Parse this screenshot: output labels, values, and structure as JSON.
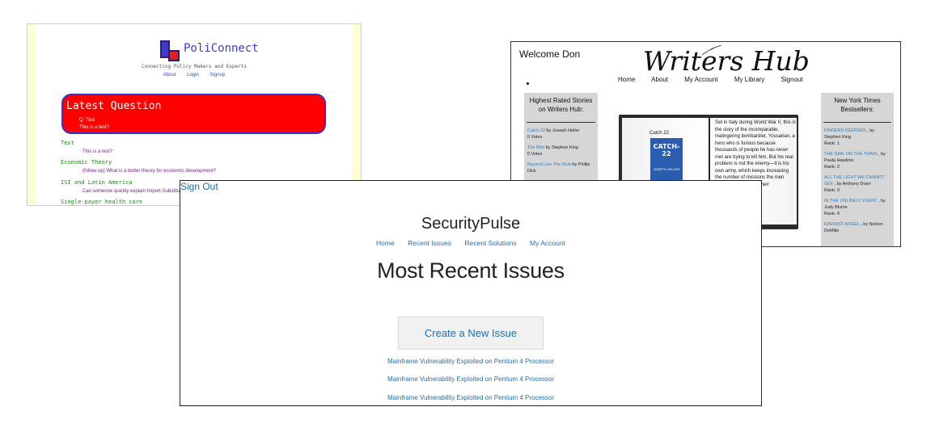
{
  "poliConnect": {
    "brand": "PoliConnect",
    "tagline": "Connecting Policy Makers and Experts",
    "nav": [
      "About",
      "Login",
      "Signup"
    ],
    "latest": {
      "heading": "Latest Question",
      "q_prefix": "Q:",
      "q_link": "Test",
      "body": "This is a test?"
    },
    "topics": [
      {
        "title": "Test",
        "text": "This is a test?"
      },
      {
        "title": "Economic Theory",
        "text": "(follow up) What is a better theory for economic development?"
      },
      {
        "title": "ISI and Latin America",
        "text": "Can someone quickly explain Import-Substitution-I"
      },
      {
        "title": "Single-payer health care",
        "text": ""
      }
    ]
  },
  "writersHub": {
    "welcome": "Welcome Don",
    "logo": "Writers Hub",
    "nav": [
      "Home",
      "About",
      "My Account",
      "My Library",
      "Signout"
    ],
    "left": {
      "heading": "Highest Rated Stories on Writers Hub:",
      "items": [
        {
          "title": "Catch 22",
          "author": " by Joseph Heller",
          "meta": "0 Votes"
        },
        {
          "title": "The Mist",
          "author": " by Stephen King",
          "meta": "0 Votes"
        },
        {
          "title": "Beyond Lies The Wub",
          "author": " by Phillip Dick",
          "meta": ""
        }
      ]
    },
    "right": {
      "heading": "New York Times Bestsellers:",
      "items": [
        {
          "title": "FINDERS KEEPERS",
          "author": " , by Stephen King",
          "meta": "Rank: 1"
        },
        {
          "title": "THE GIRL ON THE TRAIN",
          "author": " , by Paula Hawkins",
          "meta": "Rank: 2"
        },
        {
          "title": "ALL THE LIGHT WE CANNOT SEE",
          "author": " , by Anthony Doerr",
          "meta": "Rank: 3"
        },
        {
          "title": "IN THE UNLIKELY EVENT",
          "author": " , by Judy Blume",
          "meta": "Rank: 4"
        },
        {
          "title": "RADIANT ANGEL",
          "author": " , by Nelson DeMille",
          "meta": ""
        }
      ]
    },
    "book": {
      "title": "Catch 22",
      "cover_title": "CATCH-22",
      "cover_author": "JOSEPH HELLER",
      "text": "Set in Italy during World War II, this is the story of the incomparable, malingering bombardier, Yossarian, a hero who is furious because thousands of people he has never met are trying to kill him. But his real problem is not the enemy—it is his own army, which keeps increasing the number of missions the men must fly to complete their"
    }
  },
  "securityPulse": {
    "signout": "Sign Out",
    "title": "SecurityPulse",
    "nav": [
      "Home",
      "Recent Issues",
      "Recent Solutions",
      "My Account"
    ],
    "heading": "Most Recent Issues",
    "create_button": "Create a New Issue",
    "issues": [
      "Mainframe Vulnerability Exploited on Pentium 4 Processor",
      "Mainframe Vulnerability Exploited on Pentium 4 Processor",
      "Mainframe Vulnerability Exploited on Pentium 4 Processor"
    ]
  }
}
